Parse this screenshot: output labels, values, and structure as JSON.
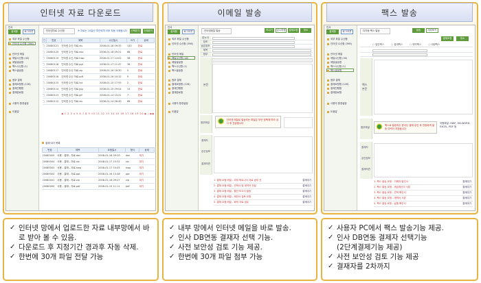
{
  "panels": [
    {
      "title": "인터넷 자료 다운로드",
      "screen": {
        "title_chip": "인터넷자료 수신함",
        "top_note": "※ 자료는 10일간 보관되며 이후 자동 삭제됩니다",
        "btn_a": "선택받기",
        "btn_b": "전체받기",
        "sidebar_tag": "인사",
        "sidebar_btn1": "결재함",
        "sidebar_btn2": "로그아웃",
        "sidebar_items": [
          "외부 파일 수신함",
          "인터넷 수신함 (398)",
          "인터넷 메일",
          "메일수신함 (40)",
          "메일발송함",
          "팩스수신함 (1)",
          "팩스발송함",
          "첨부 결재",
          "결재요청함 (128)",
          "결재진행함",
          "결재완료함",
          "사용자 환경설정",
          "도움말"
        ],
        "table1_headers": [
          "번호",
          "제목",
          "수신일시",
          "크기",
          "상태"
        ],
        "table1_rows": [
          [
            "20080121",
            "인터넷 수신 자료.xls",
            "2008-01-18 09:35",
            "120",
            "완료"
          ],
          [
            "20080120",
            "인터넷 수신 자료.doc",
            "2008-01-18 09:21",
            "88",
            "완료"
          ],
          [
            "20080119",
            "인터넷 수신 자료.hwp",
            "2008-01-17 14:02",
            "58",
            "완료"
          ],
          [
            "20080118",
            "인터넷 수신 자료.ppt",
            "2008-01-17 11:47",
            "36",
            "완료"
          ],
          [
            "20080117",
            "인터넷 수신 자료.zip",
            "2008-01-16 16:30",
            "5",
            "완료"
          ],
          [
            "20080116",
            "인터넷 수신 자료.pdf",
            "2008-01-16 10:12",
            "9",
            "완료"
          ],
          [
            "20080115",
            "인터넷 수신 자료.txt",
            "2008-01-15 17:55",
            "2",
            "완료"
          ],
          [
            "20080114",
            "인터넷 수신 자료.jpg",
            "2008-01-15 09:04",
            "14",
            "완료"
          ],
          [
            "20080113",
            "인터넷 수신 자료.gif",
            "2008-01-14 15:21",
            "7",
            "완료"
          ],
          [
            "20080112",
            "인터넷 수신 자료.xls",
            "2008-01-14 08:40",
            "66",
            "완료"
          ]
        ],
        "pager": "◀ 1 2 3 4 5 6 7 8 9 10 11 12 13 14 15 16 17 18 19 20 ▶ | ▶▶",
        "section2": "결재 대기 목록",
        "table2_headers": [
          "번호",
          "제목",
          "요청일시",
          "형식",
          "상태"
        ],
        "table2_rows": [
          [
            "20080005",
            "사용 - 결재 - 자료.doc",
            "2008-01-18 09:10",
            "doc",
            "대기"
          ],
          [
            "20080004",
            "사용 - 결재 - 자료.xls",
            "2008-01-17 15:32",
            "xls",
            "대기"
          ],
          [
            "20080003",
            "사용 - 결재 - 자료.hwp",
            "2008-01-17 10:05",
            "hwp",
            "대기"
          ],
          [
            "20080002",
            "사용 - 결재 - 자료.ppt",
            "2008-01-16 13:48",
            "ppt",
            "대기"
          ],
          [
            "20080001",
            "사용 - 결재 - 자료.zip",
            "2008-01-16 09:27",
            "zip",
            "대기"
          ],
          [
            "20080000",
            "사용 - 결재 - 자료.pdf",
            "2008-01-15 11:11",
            "pdf",
            "대기"
          ]
        ]
      },
      "bullets": [
        "인터넷 망에서 업로드한 자료 내부망에서 바로 받아 볼 수 있음.",
        "다운로드 후 지정기간 경과후 자동 삭제.",
        "한번에 30개 파일 전달 가능"
      ]
    },
    {
      "title": "이메일 발송",
      "screen": {
        "title_chip": "인터넷메일 발송",
        "btn_a": "보내기",
        "btn_b": "임시저장",
        "btn_c": "결재요청",
        "btn_d": "취소",
        "field_labels": [
          "받는이",
          "참조",
          "숨은참조",
          "제목",
          "첨부"
        ],
        "editor_label": "본문",
        "attach_label": "첨부파일",
        "notice": "인터넷 메일로 발송되는 파일은 보안 정책에 따라 검사 후 전송됩니다",
        "approve_labels": [
          "결재자",
          "승인정보",
          "결재의견"
        ],
        "list_lines": [
          "1. 결재 요청 메일 - 외부 파트너사 자료 송부 건",
          "2. 결재 요청 메일 - 견적서 및 계약서 전달",
          "3. 결재 요청 메일 - 월간 보고서 발송",
          "4. 결재 요청 메일 - 제안서 검토 요청",
          "5. 결재 요청 메일 - 회의 자료 공유"
        ],
        "list_meta": "결재대기"
      },
      "bullets": [
        "내부 망에서 인터넷 메일을 바로 발송.",
        "인사 DB연동 결재자 선택 기능.",
        "사전 보안성 검토 기능 제공.",
        "한번에 30개 파일 첨부 가능"
      ]
    },
    {
      "title": "팩스 발송",
      "screen": {
        "title_chip": "다자동 팩스 발송",
        "btn_a": "발송",
        "btn_b": "미리보기",
        "btn_c": "결재요청",
        "btn_d": "취소",
        "radio_options": [
          "일반팩스",
          "결재팩스",
          "예약팩스",
          "대량팩스"
        ],
        "side_label": "팩스 본문",
        "attach_label": "첨부파일",
        "notice": "팩스로 발송되는 문서는 결재 승인 후 전송되며 발송 이력이 저장됩니다",
        "notice_note": "지원파일: HWP, MS-WORD, EXCEL, PDF 등",
        "approve_labels": [
          "결재자",
          "승인정보",
          "결재의견"
        ],
        "list_lines": [
          "1. 팩스 발송 요청 - 거래처 발주서",
          "2. 팩스 발송 요청 - 세금계산서 사본",
          "3. 팩스 발송 요청 - 견적 확인서",
          "4. 팩스 발송 요청 - 계약서 사본",
          "5. 팩스 발송 요청 - 납품 확인서"
        ],
        "list_meta": "결재대기"
      },
      "bullets": [
        "사용자 PC에서 팩스 발송기능 제공.",
        "인사 DB연동 결제자 선택기능",
        "(2단계결제기능 제공)",
        "사전 보안성 검토 기능 제공",
        "결재자를 2차까지"
      ]
    }
  ]
}
